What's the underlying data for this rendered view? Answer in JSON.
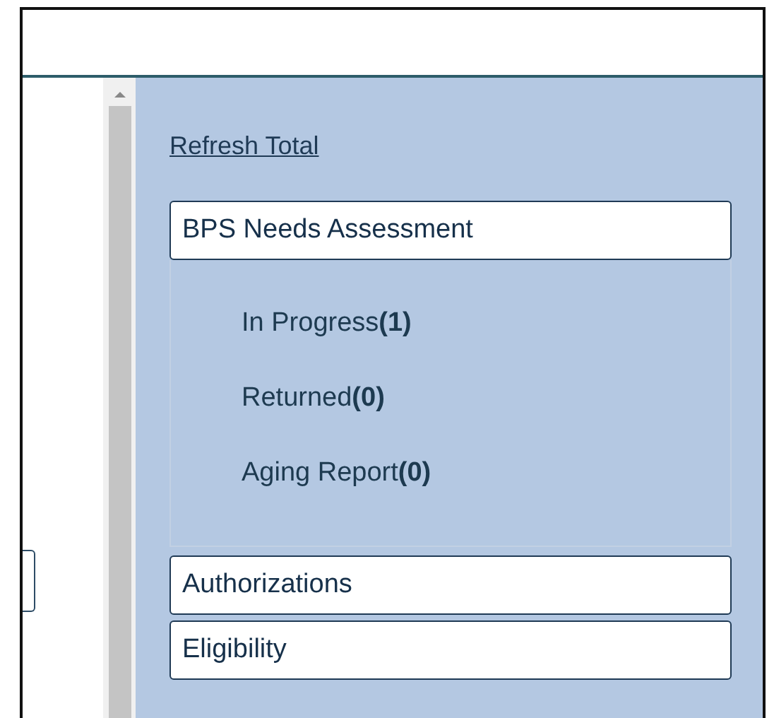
{
  "refresh_link": "Refresh Total",
  "sections": [
    {
      "title": "BPS Needs Assessment",
      "expanded": true,
      "items": [
        "In Progress**(1)**",
        "Returned**(0)**",
        "Aging Report**(0)**"
      ]
    },
    {
      "title": "Authorizations",
      "expanded": false
    },
    {
      "title": "Eligibility",
      "expanded": false
    }
  ]
}
